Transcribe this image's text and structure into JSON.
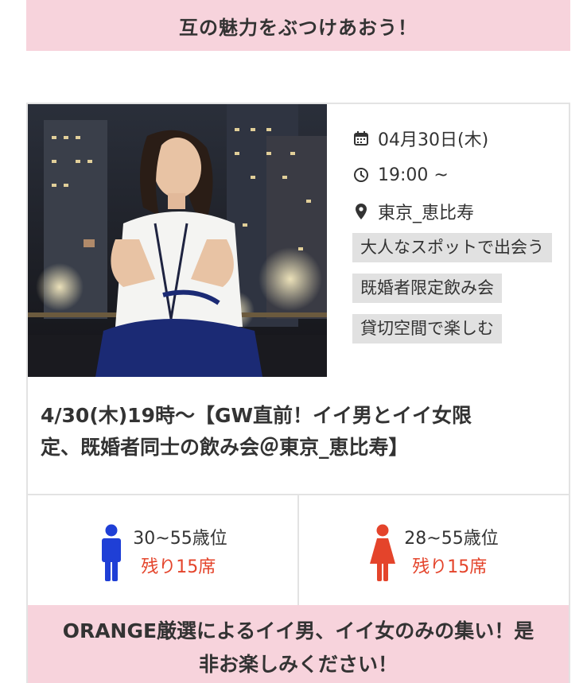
{
  "banner_top": {
    "text": "互の魅力をぶつけあおう！"
  },
  "event": {
    "date": "04月30日(木)",
    "time": "19:00 ~",
    "location": "東京_恵比寿",
    "tags": [
      "大人なスポットで出会う",
      "既婚者限定飲み会",
      "貸切空間で楽しむ"
    ],
    "title_line1": "4/30(木)19時〜【GW直前！イイ男とイイ女限",
    "title_line2": "定、既婚者同士の飲み会＠東京_恵比寿】"
  },
  "capacity": {
    "male": {
      "age": "30~55歳位",
      "remaining": "残り15席",
      "color": "#1f3fd6"
    },
    "female": {
      "age": "28~55歳位",
      "remaining": "残り15席",
      "color": "#e4442b"
    }
  },
  "banner_bottom": {
    "line1": "ORANGE厳選によるイイ男、イイ女のみの集い！是",
    "line2": "非お楽しみください！"
  },
  "colors": {
    "pink": "#f7d3dc",
    "accent_red": "#e4442b",
    "male_blue": "#1f3fd6",
    "tag_bg": "#e1e1e1"
  }
}
